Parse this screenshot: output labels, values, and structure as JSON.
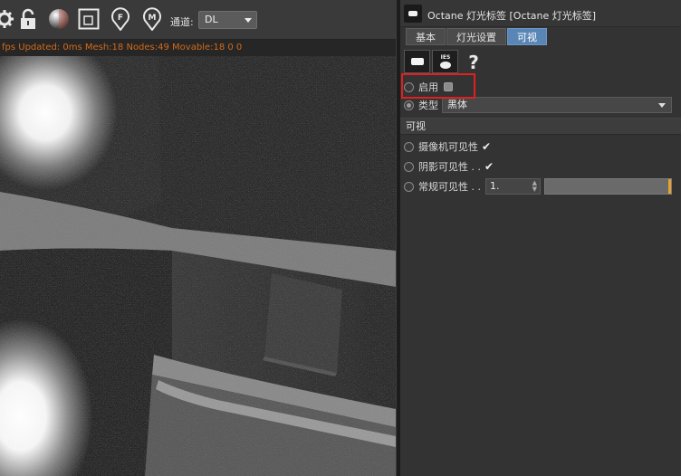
{
  "viewport": {
    "toolbar": {
      "icons": [
        "gear-icon",
        "lock-icon",
        "sphere-icon",
        "frame-icon",
        "pin-f-icon",
        "pin-m-icon"
      ],
      "pin_f_label": "F",
      "pin_m_label": "M",
      "channel_label": "通道:",
      "channel_value": "DL"
    },
    "status_text": "fps Updated: 0ms  Mesh:18 Nodes:49 Movable:18  0 0"
  },
  "panel": {
    "title": "Octane 灯光标签 [Octane 灯光标签]",
    "tabs": [
      {
        "label": "基本",
        "active": false
      },
      {
        "label": "灯光设置",
        "active": false
      },
      {
        "label": "可视",
        "active": true
      }
    ],
    "icon_buttons": [
      "light-tag-icon",
      "ies-icon",
      "help-icon"
    ],
    "ies_label": "IES",
    "help_label": "?",
    "enable": {
      "label": "启用",
      "checked": false
    },
    "type": {
      "label": "类型",
      "value": "黑体"
    },
    "section_title": "可视",
    "camera_visibility": {
      "label": "摄像机可见性",
      "checked": true,
      "mark": "✔"
    },
    "shadow_visibility": {
      "label": "阴影可见性 . .",
      "checked": true,
      "mark": "✔"
    },
    "general_visibility": {
      "label": "常规可见性 . .",
      "value": "1.",
      "level": 1.0
    }
  },
  "colors": {
    "accent_tab": "#5a86b6",
    "status_text": "#d26a1a",
    "slider_marker": "#e5a32c",
    "highlight": "#e02020"
  }
}
